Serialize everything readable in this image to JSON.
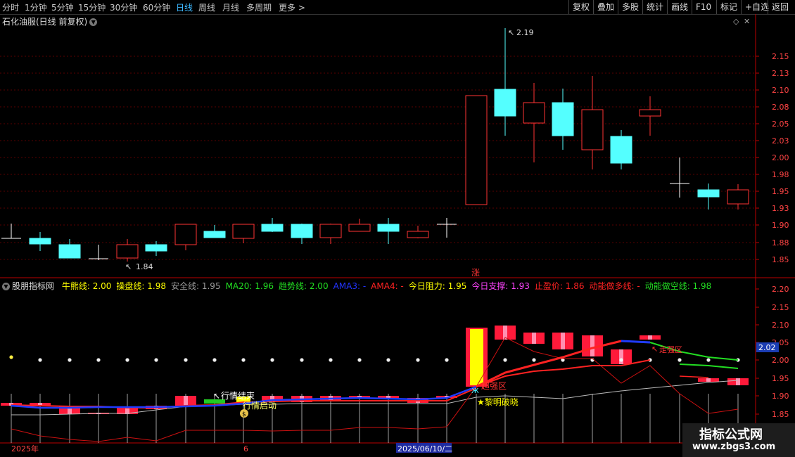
{
  "toolbar": {
    "periods": [
      "分时",
      "1分钟",
      "5分钟",
      "15分钟",
      "30分钟",
      "60分钟",
      "日线",
      "周线",
      "月线",
      "多周期",
      "更多 >"
    ],
    "active_period": "日线",
    "right_buttons": [
      "复权",
      "叠加",
      "多股",
      "统计",
      "画线",
      "F10",
      "标记",
      "+自选",
      "返回"
    ]
  },
  "main_chart": {
    "title": "石化油服(日线 前复权)",
    "price_ticks": [
      "2.15",
      "2.13",
      "2.10",
      "2.08",
      "2.05",
      "2.03",
      "2.00",
      "1.98",
      "1.95",
      "1.93",
      "1.90",
      "1.88",
      "1.85"
    ],
    "high_label": "2.19",
    "low_label": "1.84",
    "limit_up_marker": "涨"
  },
  "indicator": {
    "name": "股朋指标网",
    "fields": [
      {
        "label": "牛熊线:",
        "value": "2.00",
        "color": "#ffff00"
      },
      {
        "label": "操盘线:",
        "value": "1.98",
        "color": "#ffff00"
      },
      {
        "label": "安全线:",
        "value": "1.95",
        "color": "#9a9a9a"
      },
      {
        "label": "MA20:",
        "value": "1.96",
        "color": "#22dd22"
      },
      {
        "label": "趋势线:",
        "value": "2.00",
        "color": "#22dd22"
      },
      {
        "label": "AMA3:",
        "value": "-",
        "color": "#2233ff"
      },
      {
        "label": "AMA4:",
        "value": "-",
        "color": "#ff2222"
      },
      {
        "label": "今日阻力:",
        "value": "1.95",
        "color": "#ffff00"
      },
      {
        "label": "今日支撑:",
        "value": "1.93",
        "color": "#ff44ff"
      },
      {
        "label": "止盈价:",
        "value": "1.86",
        "color": "#ff2222"
      },
      {
        "label": "动能做多线:",
        "value": "-",
        "color": "#ff2222"
      },
      {
        "label": "动能做空线:",
        "value": "1.98",
        "color": "#22dd22"
      }
    ],
    "ticks": [
      "2.20",
      "2.15",
      "2.10",
      "2.05",
      "2.00",
      "1.95",
      "1.90",
      "1.85"
    ],
    "current_value": "2.02",
    "annotations": {
      "market_end": "行情结束",
      "market_start": "行情启动",
      "strong_zone": "超强区",
      "dawn_break": "★黎明破晓",
      "walk_strong": "走强区",
      "coin_icon": "$"
    }
  },
  "date_axis": {
    "labels": [
      "2025年",
      "6",
      "2025/06/10/二"
    ]
  },
  "watermark": {
    "title": "指标公式网",
    "url": "www.zbgs3.com"
  }
}
